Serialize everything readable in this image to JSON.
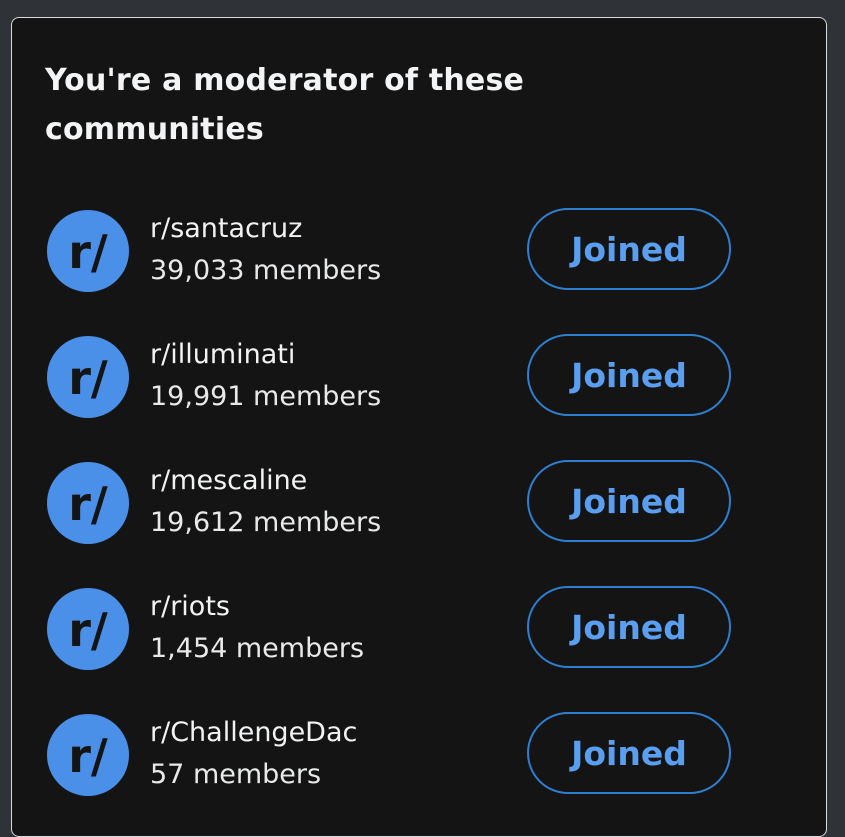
{
  "widget": {
    "title": "You're a moderator of these communities"
  },
  "communities": [
    {
      "name": "r/santacruz",
      "members": "39,033 members",
      "button_label": "Joined",
      "avatar_text": "r/"
    },
    {
      "name": "r/illuminati",
      "members": "19,991 members",
      "button_label": "Joined",
      "avatar_text": "r/"
    },
    {
      "name": "r/mescaline",
      "members": "19,612 members",
      "button_label": "Joined",
      "avatar_text": "r/"
    },
    {
      "name": "r/riots",
      "members": "1,454 members",
      "button_label": "Joined",
      "avatar_text": "r/"
    },
    {
      "name": "r/ChallengeDac",
      "members": "57 members",
      "button_label": "Joined",
      "avatar_text": "r/"
    }
  ],
  "colors": {
    "page_background": "#2f3236",
    "panel_background": "#141414",
    "panel_border": "#d8dadc",
    "avatar": "#4a90e8",
    "button_border": "#2e7fd1",
    "button_text": "#5a9ef0",
    "text": "#f1f2f3"
  },
  "icons": {
    "avatar": "subreddit-default-icon"
  }
}
